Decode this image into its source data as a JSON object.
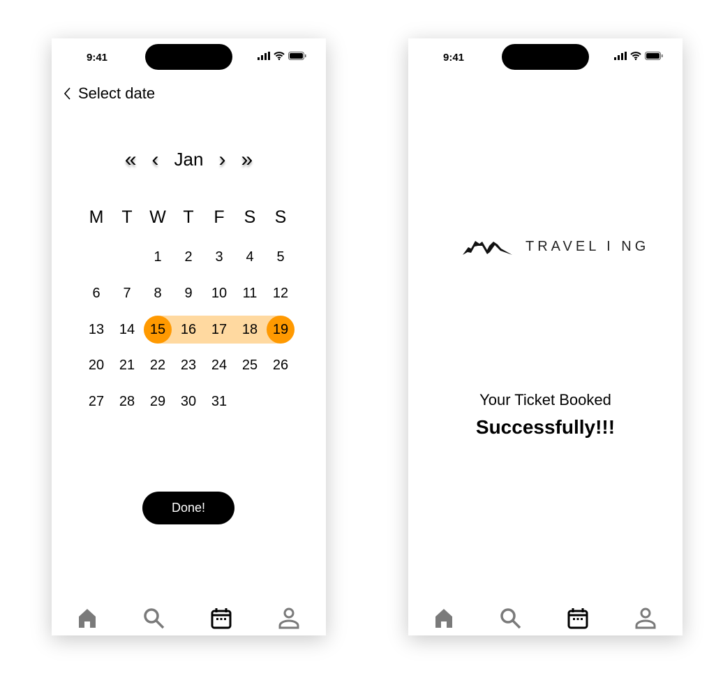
{
  "status_bar": {
    "time": "9:41"
  },
  "screen1": {
    "title": "Select date",
    "month": "Jan",
    "weekdays": [
      "M",
      "T",
      "W",
      "T",
      "F",
      "S",
      "S"
    ],
    "weeks": [
      [
        "",
        "",
        "1",
        "2",
        "3",
        "4",
        "5"
      ],
      [
        "6",
        "7",
        "8",
        "9",
        "10",
        "11",
        "12"
      ],
      [
        "13",
        "14",
        "15",
        "16",
        "17",
        "18",
        "19"
      ],
      [
        "20",
        "21",
        "22",
        "23",
        "24",
        "25",
        "26"
      ],
      [
        "27",
        "28",
        "29",
        "30",
        "31",
        "",
        ""
      ]
    ],
    "range_start": "15",
    "range_end": "19",
    "done_label": "Done!"
  },
  "screen2": {
    "logo_text": "TRAVEL I NG",
    "message_line1": "Your Ticket Booked",
    "message_line2": "Successfully!!!"
  },
  "nav": {
    "items": [
      "home-icon",
      "search-icon",
      "calendar-icon",
      "profile-icon"
    ],
    "active": "calendar-icon"
  },
  "colors": {
    "selected": "#FF9900",
    "range": "#FFD9A0",
    "inactive_icon": "#7a7a7a"
  }
}
